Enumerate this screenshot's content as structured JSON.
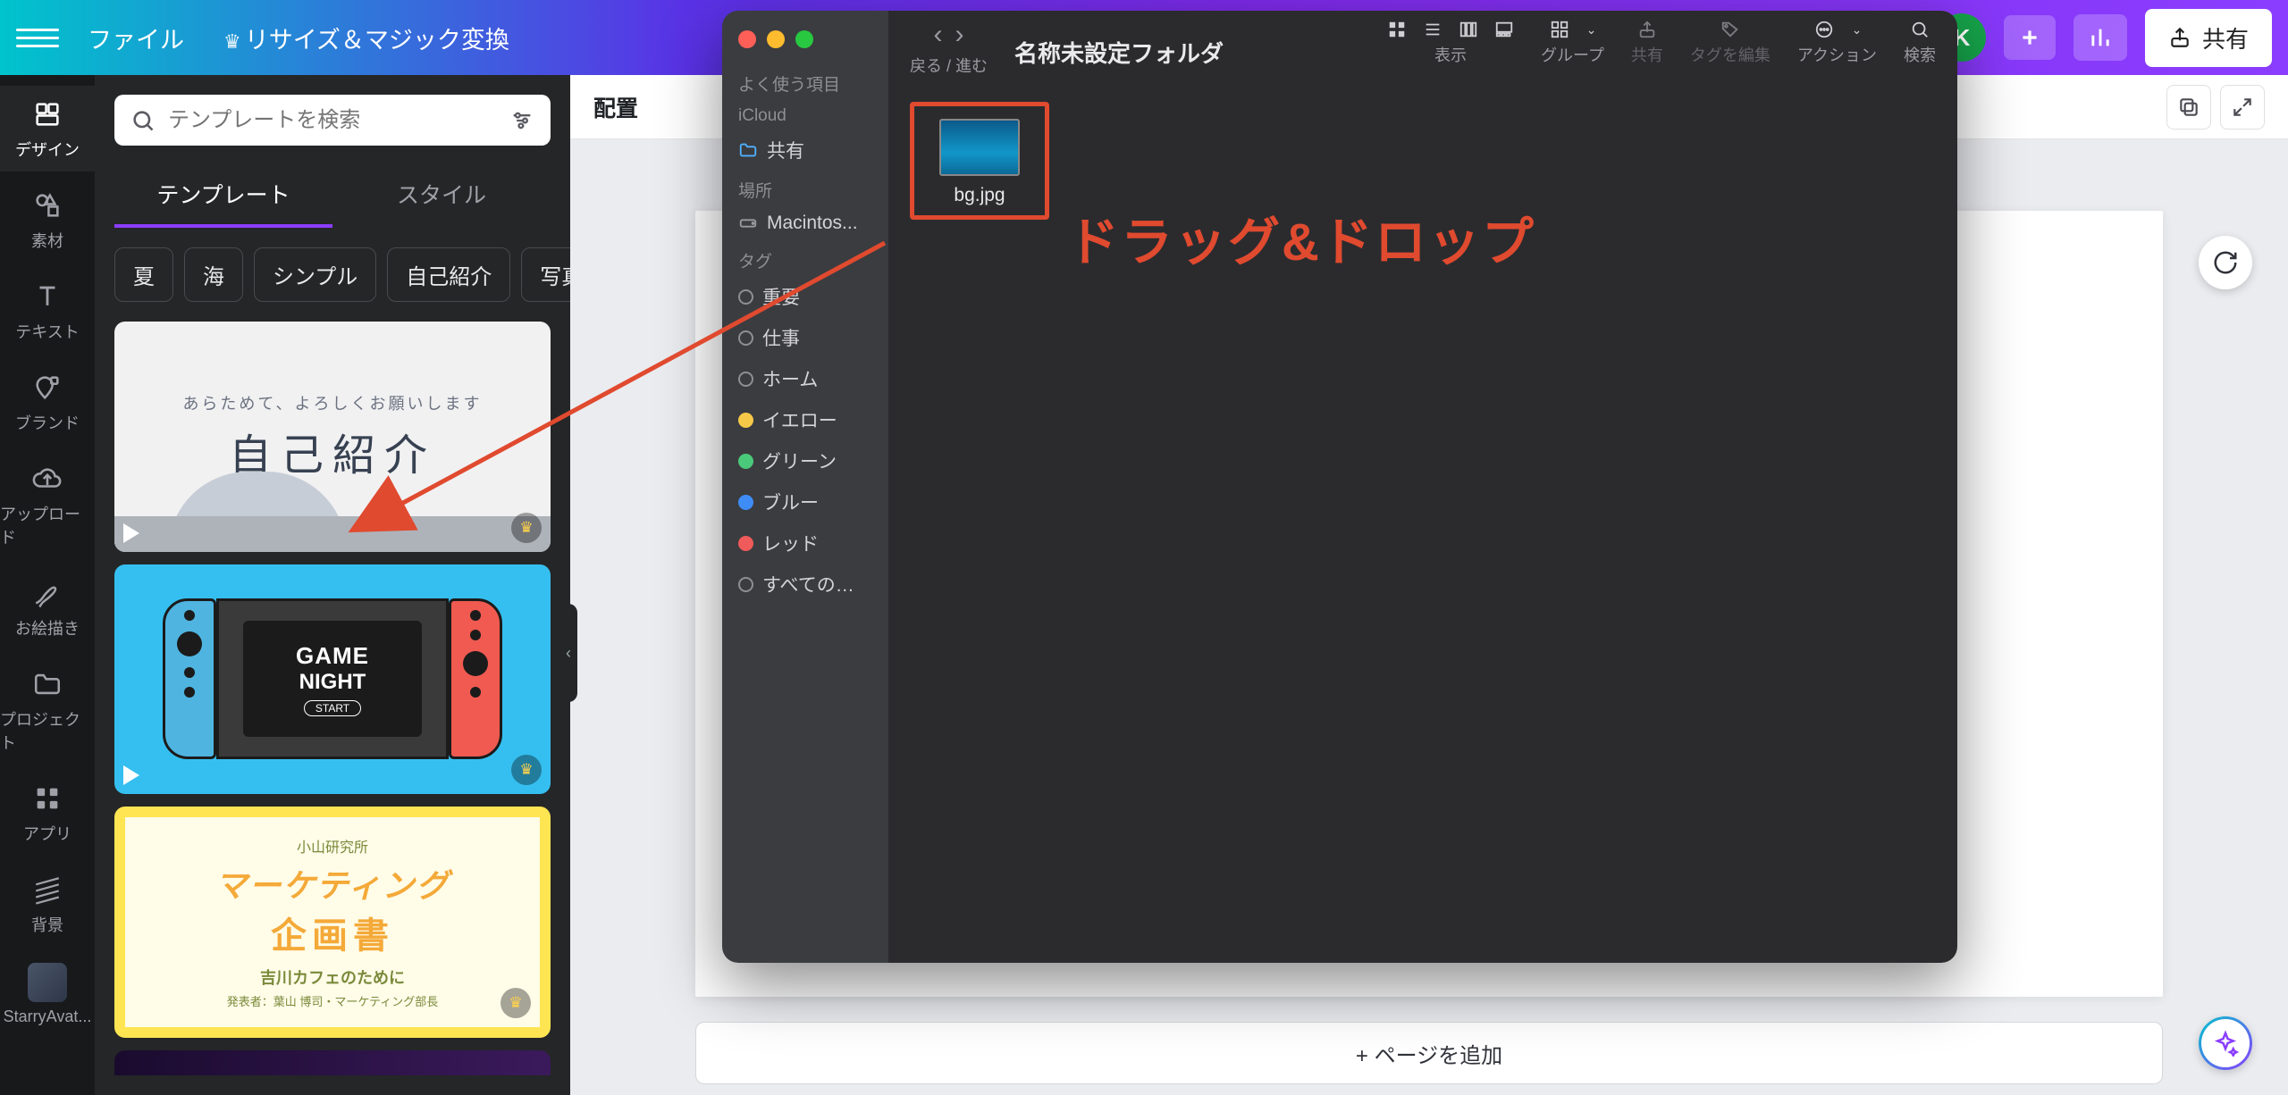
{
  "topbar": {
    "file": "ファイル",
    "resize": "リサイズ＆マジック変換",
    "share": "共有",
    "avatar_letter": "K"
  },
  "left_rail": {
    "items": [
      {
        "label": "デザイン"
      },
      {
        "label": "素材"
      },
      {
        "label": "テキスト"
      },
      {
        "label": "ブランド"
      },
      {
        "label": "アップロード"
      },
      {
        "label": "お絵描き"
      },
      {
        "label": "プロジェクト"
      },
      {
        "label": "アプリ"
      },
      {
        "label": "背景"
      },
      {
        "label": "StarryAvat..."
      }
    ]
  },
  "side_panel": {
    "search_placeholder": "テンプレートを検索",
    "tabs": {
      "templates": "テンプレート",
      "styles": "スタイル"
    },
    "chips": [
      "夏",
      "海",
      "シンプル",
      "自己紹介",
      "写真"
    ],
    "tpl1": {
      "sub": "あらためて、よろしくお願いします",
      "title": "自己紹介"
    },
    "tpl2": {
      "line1": "GAME",
      "line2": "NIGHT",
      "line3": "START"
    },
    "tpl3": {
      "s1": "小山研究所",
      "s2": "マーケティング",
      "s3": "企画書",
      "s4": "吉川カフェのために",
      "s5": "発表者：葉山 博司・マーケティング部長"
    }
  },
  "context_bar": {
    "left": "配置"
  },
  "canvas": {
    "add_page": "+ ページを追加"
  },
  "finder": {
    "title": "名称未設定フォルダ",
    "toolbar": {
      "back_forward": "戻る / 進む",
      "view": "表示",
      "group": "グループ",
      "share": "共有",
      "edit_tag": "タグを編集",
      "action": "アクション",
      "search": "検索"
    },
    "sidebar": {
      "favorites": "よく使う項目",
      "icloud": "iCloud",
      "shared": "共有",
      "locations": "場所",
      "disk": "Macintos...",
      "tags": "タグ",
      "tag_items": [
        "重要",
        "仕事",
        "ホーム",
        "イエロー",
        "グリーン",
        "ブルー",
        "レッド",
        "すべての…"
      ]
    },
    "file": {
      "name": "bg.jpg"
    },
    "annotation": "ドラッグ&ドロップ"
  }
}
